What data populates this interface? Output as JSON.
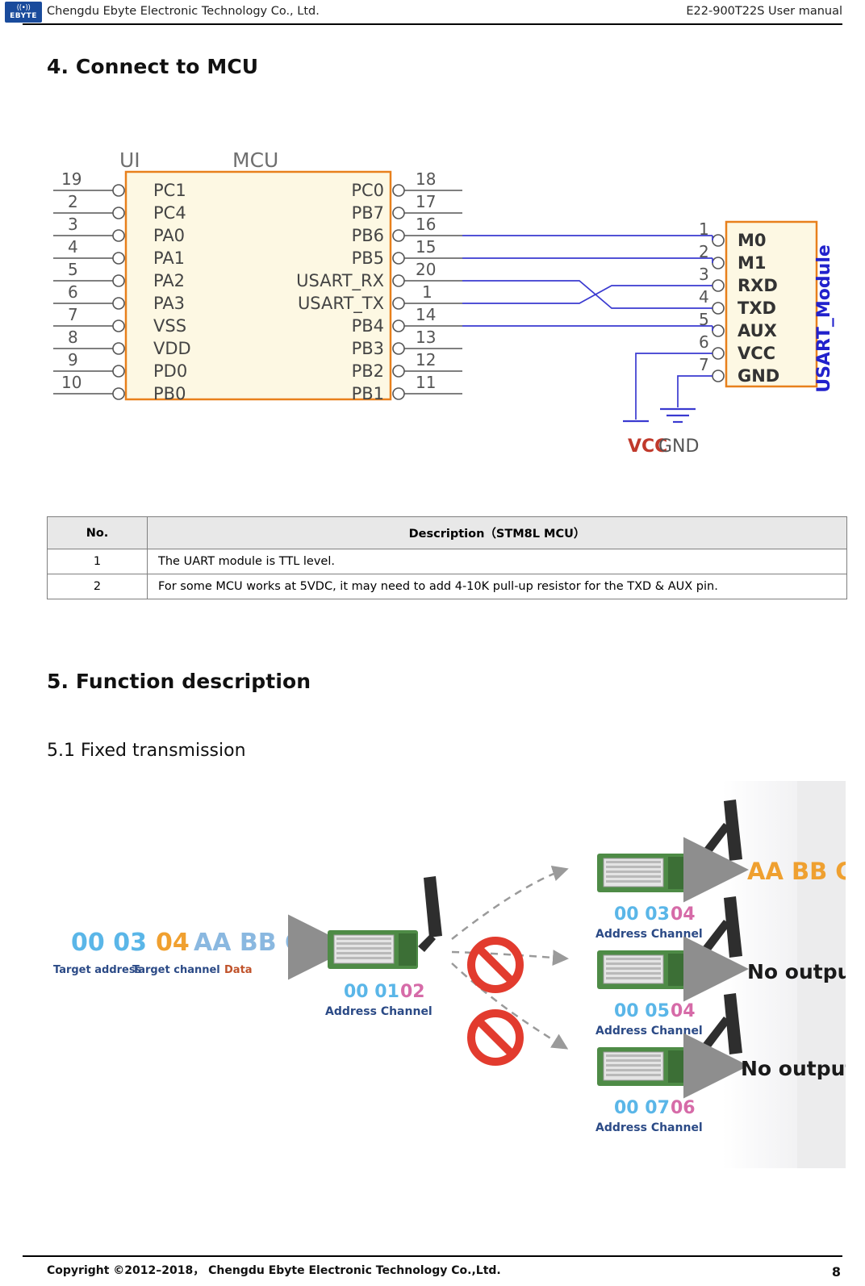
{
  "header": {
    "company": "Chengdu Ebyte Electronic Technology Co., Ltd.",
    "manual": "E22-900T22S User manual",
    "logo_mark": "((•))",
    "logo_text": "EBYTE"
  },
  "sections": {
    "connect_title": "4. Connect to MCU",
    "function_title": "5. Function description",
    "fixed_title": "5.1 Fixed transmission"
  },
  "schematic": {
    "label_ui": "UI",
    "label_mcu": "MCU",
    "label_module": "USART_Module",
    "mcu_left_pins": [
      "PC1",
      "PC4",
      "PA0",
      "PA1",
      "PA2",
      "PA3",
      "VSS",
      "VDD",
      "PD0",
      "PB0"
    ],
    "mcu_left_numbers": [
      "19",
      "2",
      "3",
      "4",
      "5",
      "6",
      "7",
      "8",
      "9",
      "10"
    ],
    "mcu_right_pins": [
      "PC0",
      "PB7",
      "PB6",
      "PB5",
      "USART_RX",
      "USART_TX",
      "PB4",
      "PB3",
      "PB2",
      "PB1"
    ],
    "mcu_right_numbers": [
      "18",
      "17",
      "16",
      "15",
      "20",
      "1",
      "14",
      "13",
      "12",
      "11"
    ],
    "module_pins": [
      "M0",
      "M1",
      "RXD",
      "TXD",
      "AUX",
      "VCC",
      "GND"
    ],
    "module_numbers": [
      "1",
      "2",
      "3",
      "4",
      "5",
      "6",
      "7"
    ],
    "power_vcc": "VCC",
    "power_gnd": "GND"
  },
  "note_table": {
    "headers": [
      "No.",
      "Description（STM8L MCU）"
    ],
    "rows": [
      {
        "no": "1",
        "desc": "The UART module is TTL level."
      },
      {
        "no": "2",
        "desc": "For some MCU works at 5VDC, it may need to add 4-10K pull-up resistor for the TXD & AUX pin."
      }
    ]
  },
  "fixed_figure": {
    "source_address": "00 03",
    "source_channel": "04",
    "source_data": "AA BB CC",
    "source_label_address": "Target address",
    "source_label_channel": "Target channel",
    "source_label_data": "Data",
    "transmitter_address": "00 01",
    "transmitter_channel": "02",
    "transmitter_label": "Address Channel",
    "receivers": [
      {
        "address": "00 03",
        "channel": "04",
        "label": "Address Channel",
        "output": "AA BB CC",
        "blocked": false
      },
      {
        "address": "00 05",
        "channel": "04",
        "label": "Address Channel",
        "output": "No output",
        "blocked": true
      },
      {
        "address": "00 07",
        "channel": "06",
        "label": "Address Channel",
        "output": "No output",
        "blocked": true
      }
    ]
  },
  "footer": {
    "copyright": "Copyright ©2012–2018， Chengdu Ebyte Electronic Technology Co.,Ltd.",
    "page_number": "8"
  }
}
